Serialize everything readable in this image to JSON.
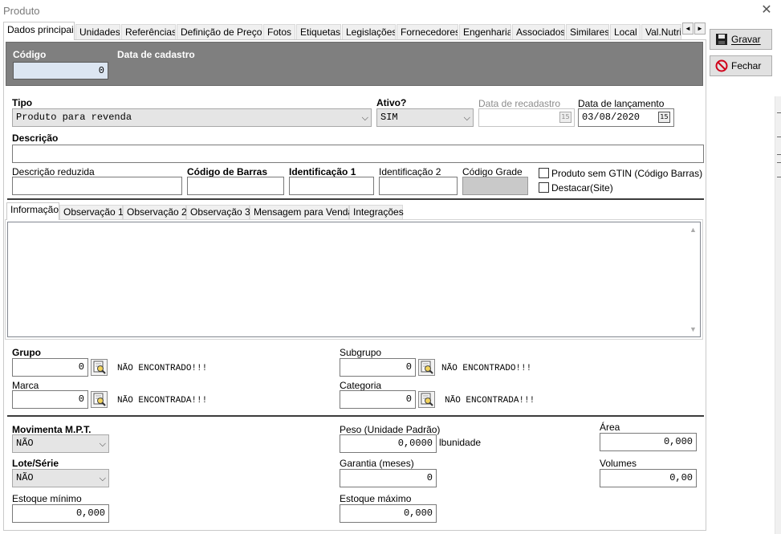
{
  "window": {
    "title": "Produto",
    "close_glyph": "✕"
  },
  "tabs": [
    {
      "label": "Dados principais"
    },
    {
      "label": "Unidades"
    },
    {
      "label": "Referências"
    },
    {
      "label": "Definição de Preços"
    },
    {
      "label": "Fotos"
    },
    {
      "label": "Etiquetas"
    },
    {
      "label": "Legislações"
    },
    {
      "label": "Fornecedores"
    },
    {
      "label": "Engenharia"
    },
    {
      "label": "Associados"
    },
    {
      "label": "Similares"
    },
    {
      "label": "Local"
    },
    {
      "label": "Val.Nutric"
    }
  ],
  "tab_scroll": {
    "left": "◄",
    "right": "►"
  },
  "actions": {
    "save_label": "Gravar",
    "close_label": "Fechar"
  },
  "header": {
    "codigo_label": "Código",
    "codigo_value": "0",
    "data_cadastro_label": "Data de cadastro"
  },
  "form": {
    "tipo_label": "Tipo",
    "tipo_value": "Produto para revenda",
    "ativo_label": "Ativo?",
    "ativo_value": "SIM",
    "data_recadastro_label": "Data de recadastro",
    "data_recadastro_value": "  /  /",
    "data_lancamento_label": "Data de lançamento",
    "data_lancamento_value": "03/08/2020",
    "calendar_glyph": "15",
    "descricao_label": "Descrição",
    "descricao_value": "",
    "descricao_reduzida_label": "Descrição reduzida",
    "codigo_barras_label": "Código de Barras",
    "identificacao1_label": "Identificação 1",
    "identificacao2_label": "Identificação 2",
    "codigo_grade_label": "Código Grade",
    "sem_gtin_label": "Produto sem GTIN (Código Barras)",
    "destacar_label": "Destacar(Site)"
  },
  "subtabs": [
    {
      "label": "Informação"
    },
    {
      "label": "Observação 1"
    },
    {
      "label": "Observação 2"
    },
    {
      "label": "Observação 3"
    },
    {
      "label": "Mensagem para Vendas"
    },
    {
      "label": "Integrações"
    }
  ],
  "classification": {
    "grupo_label": "Grupo",
    "grupo_value": "0",
    "grupo_status": "NÃO ENCONTRADO!!!",
    "subgrupo_label": "Subgrupo",
    "subgrupo_value": "0",
    "subgrupo_status": "NÃO ENCONTRADO!!!",
    "marca_label": "Marca",
    "marca_value": "0",
    "marca_status": "NÃO ENCONTRADA!!!",
    "categoria_label": "Categoria",
    "categoria_value": "0",
    "categoria_status": "NÃO ENCONTRADA!!!"
  },
  "stock": {
    "movimenta_label": "Movimenta M.P.T.",
    "movimenta_value": "NÃO",
    "peso_label": "Peso (Unidade Padrão)",
    "peso_value": "0,0000",
    "peso_unit": "lbunidade",
    "area_label": "Área",
    "area_value": "0,000",
    "lote_label": "Lote/Série",
    "lote_value": "NÃO",
    "garantia_label": "Garantia (meses)",
    "garantia_value": "0",
    "volumes_label": "Volumes",
    "volumes_value": "0,00",
    "estoque_min_label": "Estoque mínimo",
    "estoque_min_value": "0,000",
    "estoque_max_label": "Estoque máximo",
    "estoque_max_value": "0,000"
  }
}
